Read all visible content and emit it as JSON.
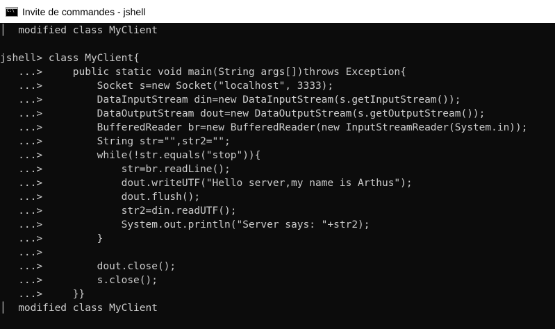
{
  "window": {
    "title": "Invite de commandes - jshell",
    "icon": "command-prompt-icon"
  },
  "console": {
    "lines": [
      "│  modified class MyClient",
      "",
      "jshell> class MyClient{",
      "   ...>     public static void main(String args[])throws Exception{",
      "   ...>         Socket s=new Socket(\"localhost\", 3333);",
      "   ...>         DataInputStream din=new DataInputStream(s.getInputStream());",
      "   ...>         DataOutputStream dout=new DataOutputStream(s.getOutputStream());",
      "   ...>         BufferedReader br=new BufferedReader(new InputStreamReader(System.in));",
      "   ...>         String str=\"\",str2=\"\";",
      "   ...>         while(!str.equals(\"stop\")){",
      "   ...>             str=br.readLine();",
      "   ...>             dout.writeUTF(\"Hello server,my name is Arthus\");",
      "   ...>             dout.flush();",
      "   ...>             str2=din.readUTF();",
      "   ...>             System.out.println(\"Server says: \"+str2);",
      "   ...>         }",
      "   ...>",
      "   ...>         dout.close();",
      "   ...>         s.close();",
      "   ...>     }}",
      "│  modified class MyClient"
    ]
  },
  "colors": {
    "background": "#0c0c0c",
    "text": "#cccccc",
    "titlebar": "#ffffff"
  }
}
